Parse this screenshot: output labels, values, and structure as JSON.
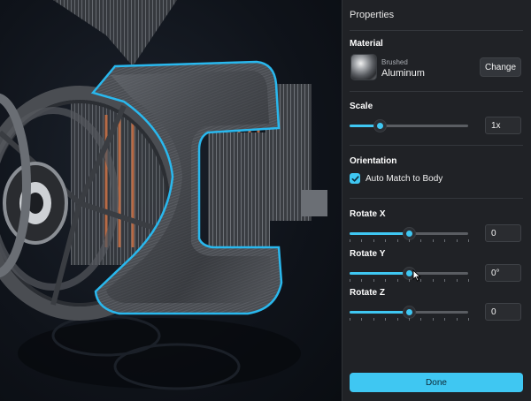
{
  "panel": {
    "title": "Properties",
    "material": {
      "section_label": "Material",
      "sub_label": "Brushed",
      "name": "Aluminum",
      "change_label": "Change"
    },
    "scale": {
      "section_label": "Scale",
      "value": "1x",
      "level": 0.25
    },
    "orientation": {
      "section_label": "Orientation",
      "auto_match_label": "Auto Match to Body",
      "checked": true
    },
    "rotate_x": {
      "section_label": "Rotate X",
      "value": "0",
      "level": 0.5
    },
    "rotate_y": {
      "section_label": "Rotate Y",
      "value": "0°",
      "level": 0.5
    },
    "rotate_z": {
      "section_label": "Rotate Z",
      "value": "0",
      "level": 0.5
    },
    "done_label": "Done"
  },
  "colors": {
    "accent": "#3fc7f2",
    "panel_bg": "#202226",
    "viewport_bg": "#0f131a",
    "selection_outline": "#29b8ee"
  },
  "icons": {
    "checkbox": "checkmark-icon",
    "cursor": "pointer-cursor-icon"
  }
}
